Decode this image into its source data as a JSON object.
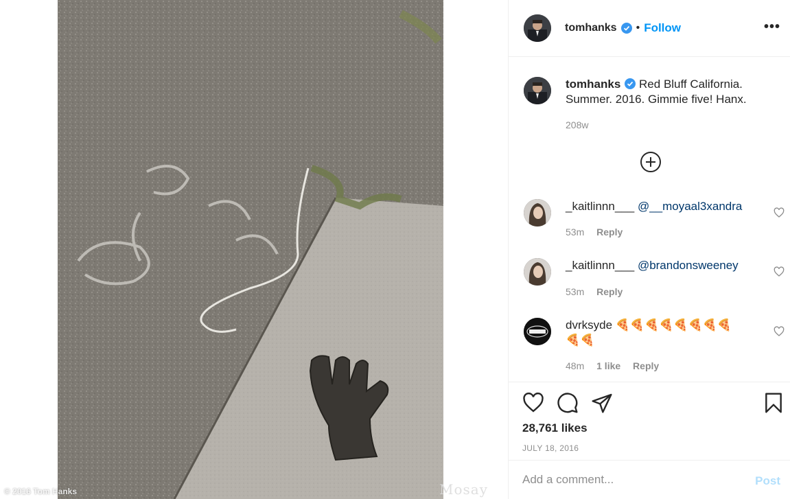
{
  "media": {
    "watermark_left": "© 2016 Tom Hanks",
    "watermark_right": "Mosay"
  },
  "header": {
    "username": "tomhanks",
    "separator": "•",
    "follow_label": "Follow",
    "more_label": "•••"
  },
  "caption": {
    "username": "tomhanks",
    "text": "Red Bluff California. Summer. 2016. Gimmie five! Hanx.",
    "time": "208w"
  },
  "comments": [
    {
      "username": "_kaitlinnn___",
      "text": "@__moyaal3xandra",
      "time": "53m",
      "likes": "",
      "reply_label": "Reply"
    },
    {
      "username": "_kaitlinnn___",
      "text": "@brandonsweeney",
      "time": "53m",
      "likes": "",
      "reply_label": "Reply"
    },
    {
      "username": "dvrksyde",
      "text": "🍕🍕🍕🍕🍕🍕🍕🍕🍕🍕",
      "time": "48m",
      "likes": "1 like",
      "reply_label": "Reply"
    }
  ],
  "actions": {
    "likes_count": "28,761 likes",
    "date": "JULY 18, 2016"
  },
  "add_comment": {
    "placeholder": "Add a comment...",
    "post_label": "Post"
  },
  "colors": {
    "accent": "#0095f6",
    "mention": "#00376b",
    "muted": "#8e8e8e",
    "text": "#262626",
    "post_disabled": "#b2dffc"
  },
  "icons": [
    "verified-badge-icon",
    "more-options-icon",
    "load-more-plus-icon",
    "heart-icon",
    "comment-icon",
    "share-icon",
    "bookmark-icon"
  ]
}
